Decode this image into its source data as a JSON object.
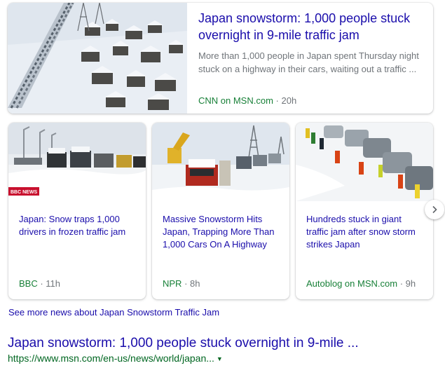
{
  "top_story": {
    "title": "Japan snowstorm: 1,000 people stuck overnight in 9-mile traffic jam",
    "snippet": "More than 1,000 people in Japan spent Thursday night stuck on a highway in their cars, waiting out a traffic ...",
    "source": "CNN on MSN.com",
    "age": "20h"
  },
  "stories": [
    {
      "title": "Japan: Snow traps 1,000 drivers in frozen traffic jam",
      "source": "BBC",
      "age": "11h",
      "badge": "BBC NEWS"
    },
    {
      "title": "Massive Snowstorm Hits Japan, Trapping More Than 1,000 Cars On A Highway",
      "source": "NPR",
      "age": "8h"
    },
    {
      "title": "Hundreds stuck in giant traffic jam after snow storm strikes Japan",
      "source": "Autoblog on MSN.com",
      "age": "9h"
    }
  ],
  "see_more": "See more news about Japan Snowstorm Traffic Jam",
  "result": {
    "title": "Japan snowstorm: 1,000 people stuck overnight in 9-mile ...",
    "url": "https://www.msn.com/en-us/news/world/japan..."
  },
  "icons": {
    "next": "chevron-right-icon",
    "url_menu": "caret-down-icon"
  },
  "colors": {
    "link": "#1a0dab",
    "source": "#188038",
    "url": "#006621",
    "meta": "#70757a"
  }
}
